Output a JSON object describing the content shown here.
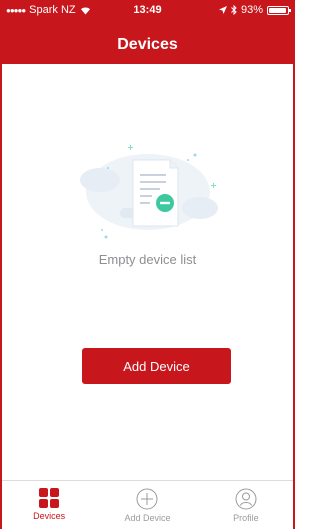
{
  "status_bar": {
    "signal_dots": "●●●●●",
    "carrier": "Spark NZ",
    "time": "13:49",
    "battery": "93%"
  },
  "header": {
    "title": "Devices"
  },
  "empty_state": {
    "message": "Empty device list"
  },
  "main": {
    "add_button_label": "Add Device"
  },
  "tabbar": {
    "tabs": [
      {
        "label": "Devices",
        "icon": "devices-grid-icon",
        "active": true
      },
      {
        "label": "Add Device",
        "icon": "plus-circle-icon",
        "active": false
      },
      {
        "label": "Profile",
        "icon": "profile-icon",
        "active": false
      }
    ]
  },
  "colors": {
    "accent": "#c8161d",
    "muted_text": "#8e8e93"
  }
}
